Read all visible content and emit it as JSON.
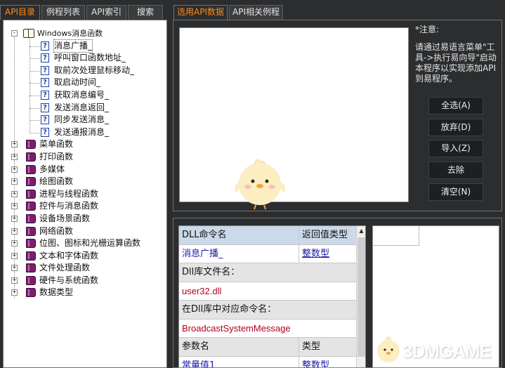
{
  "left_tabs": [
    "API目录",
    "例程列表",
    "API索引",
    "搜索"
  ],
  "tree": {
    "root_label": "Windows消息函数",
    "root_children": [
      "消息广播_",
      "呼叫窗口函数地址_",
      "取前次处理鼠标移动_",
      "取启动时间_",
      "获取消息编号_",
      "发送消息返回_",
      "同步发送消息_",
      "发送通报消息_"
    ],
    "categories": [
      "菜单函数",
      "打印函数",
      "多媒体",
      "绘图函数",
      "进程与线程函数",
      "控件与消息函数",
      "设备场景函数",
      "网络函数",
      "位图、图标和光栅运算函数",
      "文本和字体函数",
      "文件处理函数",
      "硬件与系统函数",
      "数据类型"
    ],
    "expander_open": "-",
    "expander_closed": "+",
    "help_glyph": "?"
  },
  "right_tabs": [
    "选用API数据",
    "API相关例程"
  ],
  "note": {
    "title": "*注意:",
    "body": "请通过易语言菜单\"工具->执行易向导\"启动本程序以实现添加API到易程序。"
  },
  "buttons": [
    "全选(A)",
    "放弃(D)",
    "导入(Z)",
    "去除",
    "清空(N)"
  ],
  "detail": {
    "h1": "DLL命令名",
    "h2": "返回值类型",
    "cmd_name": "消息广播_",
    "ret_type": "整数型",
    "lib_label": "Dll库文件名：",
    "lib_value": "user32.dll",
    "cmd_label": "在Dll库中对应命令名：",
    "cmd_value": "BroadcastSystemMessage",
    "param_h1": "参数名",
    "param_h2": "类型",
    "param_name": "常量值1",
    "param_type": "整数型",
    "scroll_up": "▲"
  },
  "watermark": "3DMGAME",
  "colors": {
    "accent": "#ff8c1a",
    "background": "#2b2d2f",
    "link": "#1a1aa8",
    "dll_red": "#b3001a"
  }
}
